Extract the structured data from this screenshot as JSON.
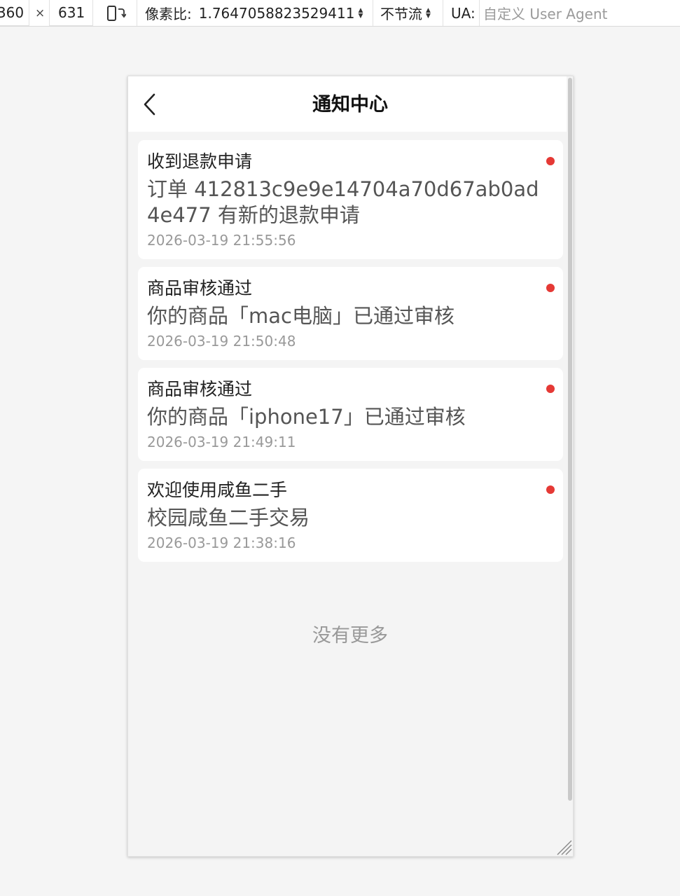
{
  "toolbar": {
    "width_value": "360",
    "times_sign": "×",
    "height_value": "631",
    "rotate_icon": "rotate-device-icon",
    "dpr_label": "像素比:",
    "dpr_value": "1.7647058823529411",
    "throttle_label": "不节流",
    "ua_label": "UA:",
    "ua_placeholder": "自定义 User Agent"
  },
  "page": {
    "back_icon": "chevron-left-icon",
    "title": "通知中心",
    "no_more_text": "没有更多",
    "unread_color": "#e53935"
  },
  "notifications": [
    {
      "title": "收到退款申请",
      "body": "订单 412813c9e9e14704a70d67ab0ad4e477 有新的退款申请",
      "time": "2026-03-19 21:55:56",
      "unread": true
    },
    {
      "title": "商品审核通过",
      "body": "你的商品「mac电脑」已通过审核",
      "time": "2026-03-19 21:50:48",
      "unread": true
    },
    {
      "title": "商品审核通过",
      "body": "你的商品「iphone17」已通过审核",
      "time": "2026-03-19 21:49:11",
      "unread": true
    },
    {
      "title": "欢迎使用咸鱼二手",
      "body": "校园咸鱼二手交易",
      "time": "2026-03-19 21:38:16",
      "unread": true
    }
  ]
}
